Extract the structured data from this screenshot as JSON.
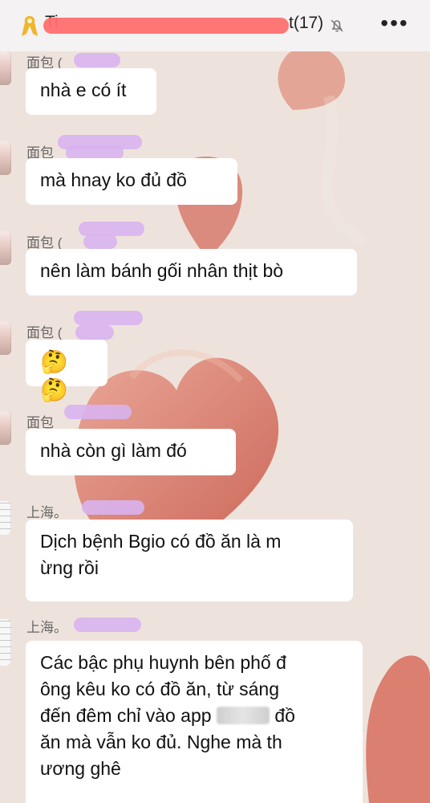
{
  "header": {
    "title_start": "Ti",
    "title_end": "t(17)",
    "icons": [
      "ribbon-icon",
      "muted-bell-icon",
      "more-icon"
    ]
  },
  "messages": [
    {
      "sender": "面包 (",
      "text": "nhà e có ít",
      "avatar": "bread-avatar"
    },
    {
      "sender": "面包",
      "text": "mà hnay ko đủ đồ",
      "avatar": "bread-avatar"
    },
    {
      "sender": "面包 (",
      "text": "nên làm bánh gối nhân thịt bò",
      "avatar": "bread-avatar"
    },
    {
      "sender": "面包 (",
      "text": "🤔🤔",
      "avatar": "bread-avatar"
    },
    {
      "sender": "面包",
      "text": "nhà còn gì làm đó",
      "avatar": "bread-avatar"
    },
    {
      "sender": "上海。",
      "text_line1": "Dịch bệnh Bgio có đồ ăn là m",
      "text_line2": "ừng rồi",
      "avatar": "shanghai-avatar"
    },
    {
      "sender": "上海。",
      "text_line1": "Các bậc phụ huynh bên phố đ",
      "text_line2": "ông kêu ko có đồ ăn, từ sáng",
      "text_line3_start": "đến đêm chỉ vào app",
      "text_line3_end": "đồ",
      "text_line4": "ăn mà vẫn ko đủ. Nghe mà th",
      "text_line5": "ương ghê",
      "avatar": "shanghai-avatar"
    }
  ],
  "colors": {
    "background": "#ede2db",
    "bubble": "#ffffff",
    "redact_red": "#ff6f6f",
    "redact_purple": "#d8b3ef",
    "heart": "#d97767"
  }
}
